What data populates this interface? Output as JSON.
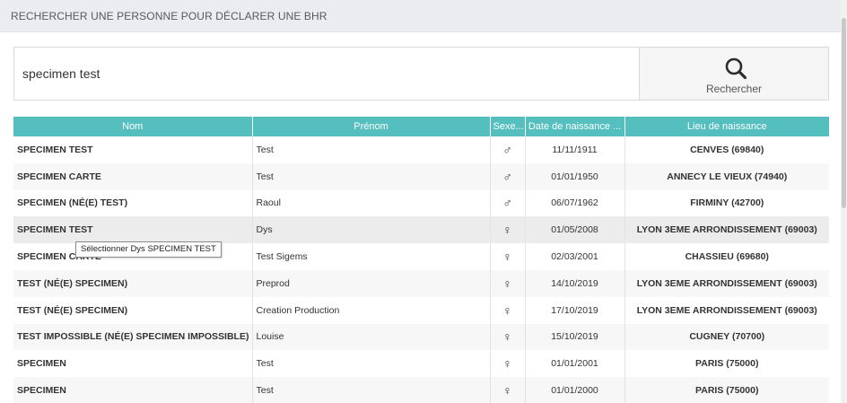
{
  "header": {
    "title": "RECHERCHER UNE PERSONNE POUR DÉCLARER UNE BHR"
  },
  "search": {
    "value": "specimen test",
    "button_label": "Rechercher",
    "icon": "search-icon"
  },
  "table": {
    "columns": {
      "nom": "Nom",
      "prenom": "Prénom",
      "sexe": "Sexe...",
      "date": "Date de naissance ...",
      "lieu": "Lieu de naissance"
    },
    "rows": [
      {
        "nom": "SPECIMEN TEST",
        "prenom": "Test",
        "sexe": "♂",
        "sexe_icon": "male-icon",
        "date": "11/11/1911",
        "lieu": "CENVES (69840)"
      },
      {
        "nom": "SPECIMEN CARTE",
        "prenom": "Test",
        "sexe": "♂",
        "sexe_icon": "male-icon",
        "date": "01/01/1950",
        "lieu": "ANNECY LE VIEUX (74940)"
      },
      {
        "nom": "SPECIMEN (NÉ(E) TEST)",
        "prenom": "Raoul",
        "sexe": "♂",
        "sexe_icon": "male-icon",
        "date": "06/07/1962",
        "lieu": "FIRMINY (42700)"
      },
      {
        "nom": "SPECIMEN TEST",
        "prenom": "Dys",
        "sexe": "♀",
        "sexe_icon": "female-icon",
        "date": "01/05/2008",
        "lieu": "LYON 3EME ARRONDISSEMENT (69003)"
      },
      {
        "nom": "SPECIMEN CARTE",
        "prenom": "Test Sigems",
        "sexe": "♀",
        "sexe_icon": "female-icon",
        "date": "02/03/2001",
        "lieu": "CHASSIEU (69680)"
      },
      {
        "nom": "TEST (NÉ(E) SPECIMEN)",
        "prenom": "Preprod",
        "sexe": "♀",
        "sexe_icon": "female-icon",
        "date": "14/10/2019",
        "lieu": "LYON 3EME ARRONDISSEMENT (69003)"
      },
      {
        "nom": "TEST (NÉ(E) SPECIMEN)",
        "prenom": "Creation Production",
        "sexe": "♀",
        "sexe_icon": "female-icon",
        "date": "17/10/2019",
        "lieu": "LYON 3EME ARRONDISSEMENT (69003)"
      },
      {
        "nom": "TEST IMPOSSIBLE (NÉ(E) SPECIMEN IMPOSSIBLE)",
        "prenom": "Louise",
        "sexe": "♀",
        "sexe_icon": "female-icon",
        "date": "15/10/2019",
        "lieu": "CUGNEY (70700)"
      },
      {
        "nom": "SPECIMEN",
        "prenom": "Test",
        "sexe": "♀",
        "sexe_icon": "female-icon",
        "date": "01/01/2001",
        "lieu": "PARIS (75000)"
      },
      {
        "nom": "SPECIMEN",
        "prenom": "Test",
        "sexe": "♀",
        "sexe_icon": "female-icon",
        "date": "01/01/2000",
        "lieu": "PARIS (75000)"
      }
    ]
  },
  "tooltip": {
    "text": "Sélectionner Dys SPECIMEN TEST"
  },
  "colors": {
    "table_header": "#55bfc0",
    "header_bar": "#eaecef"
  }
}
